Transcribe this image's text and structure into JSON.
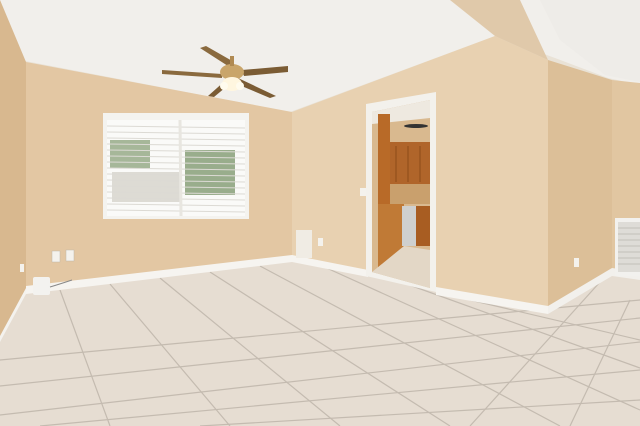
{
  "scene": {
    "description_visible_text": "",
    "colors": {
      "ceiling": "#f2f0ec",
      "wall_left": "#e2c6a2",
      "wall_back": "#e6cfae",
      "wall_right": "#e0c39c",
      "floor": "#e7ded4",
      "grout": "#bdb5aa",
      "baseboard": "#f5f3ef",
      "cabinet": "#b86a28",
      "window_light": "#f6f6f4"
    },
    "icons": [
      "ceiling-fan",
      "window-blinds",
      "doorway",
      "kitchen-cabinets",
      "air-vent",
      "outlet"
    ]
  }
}
